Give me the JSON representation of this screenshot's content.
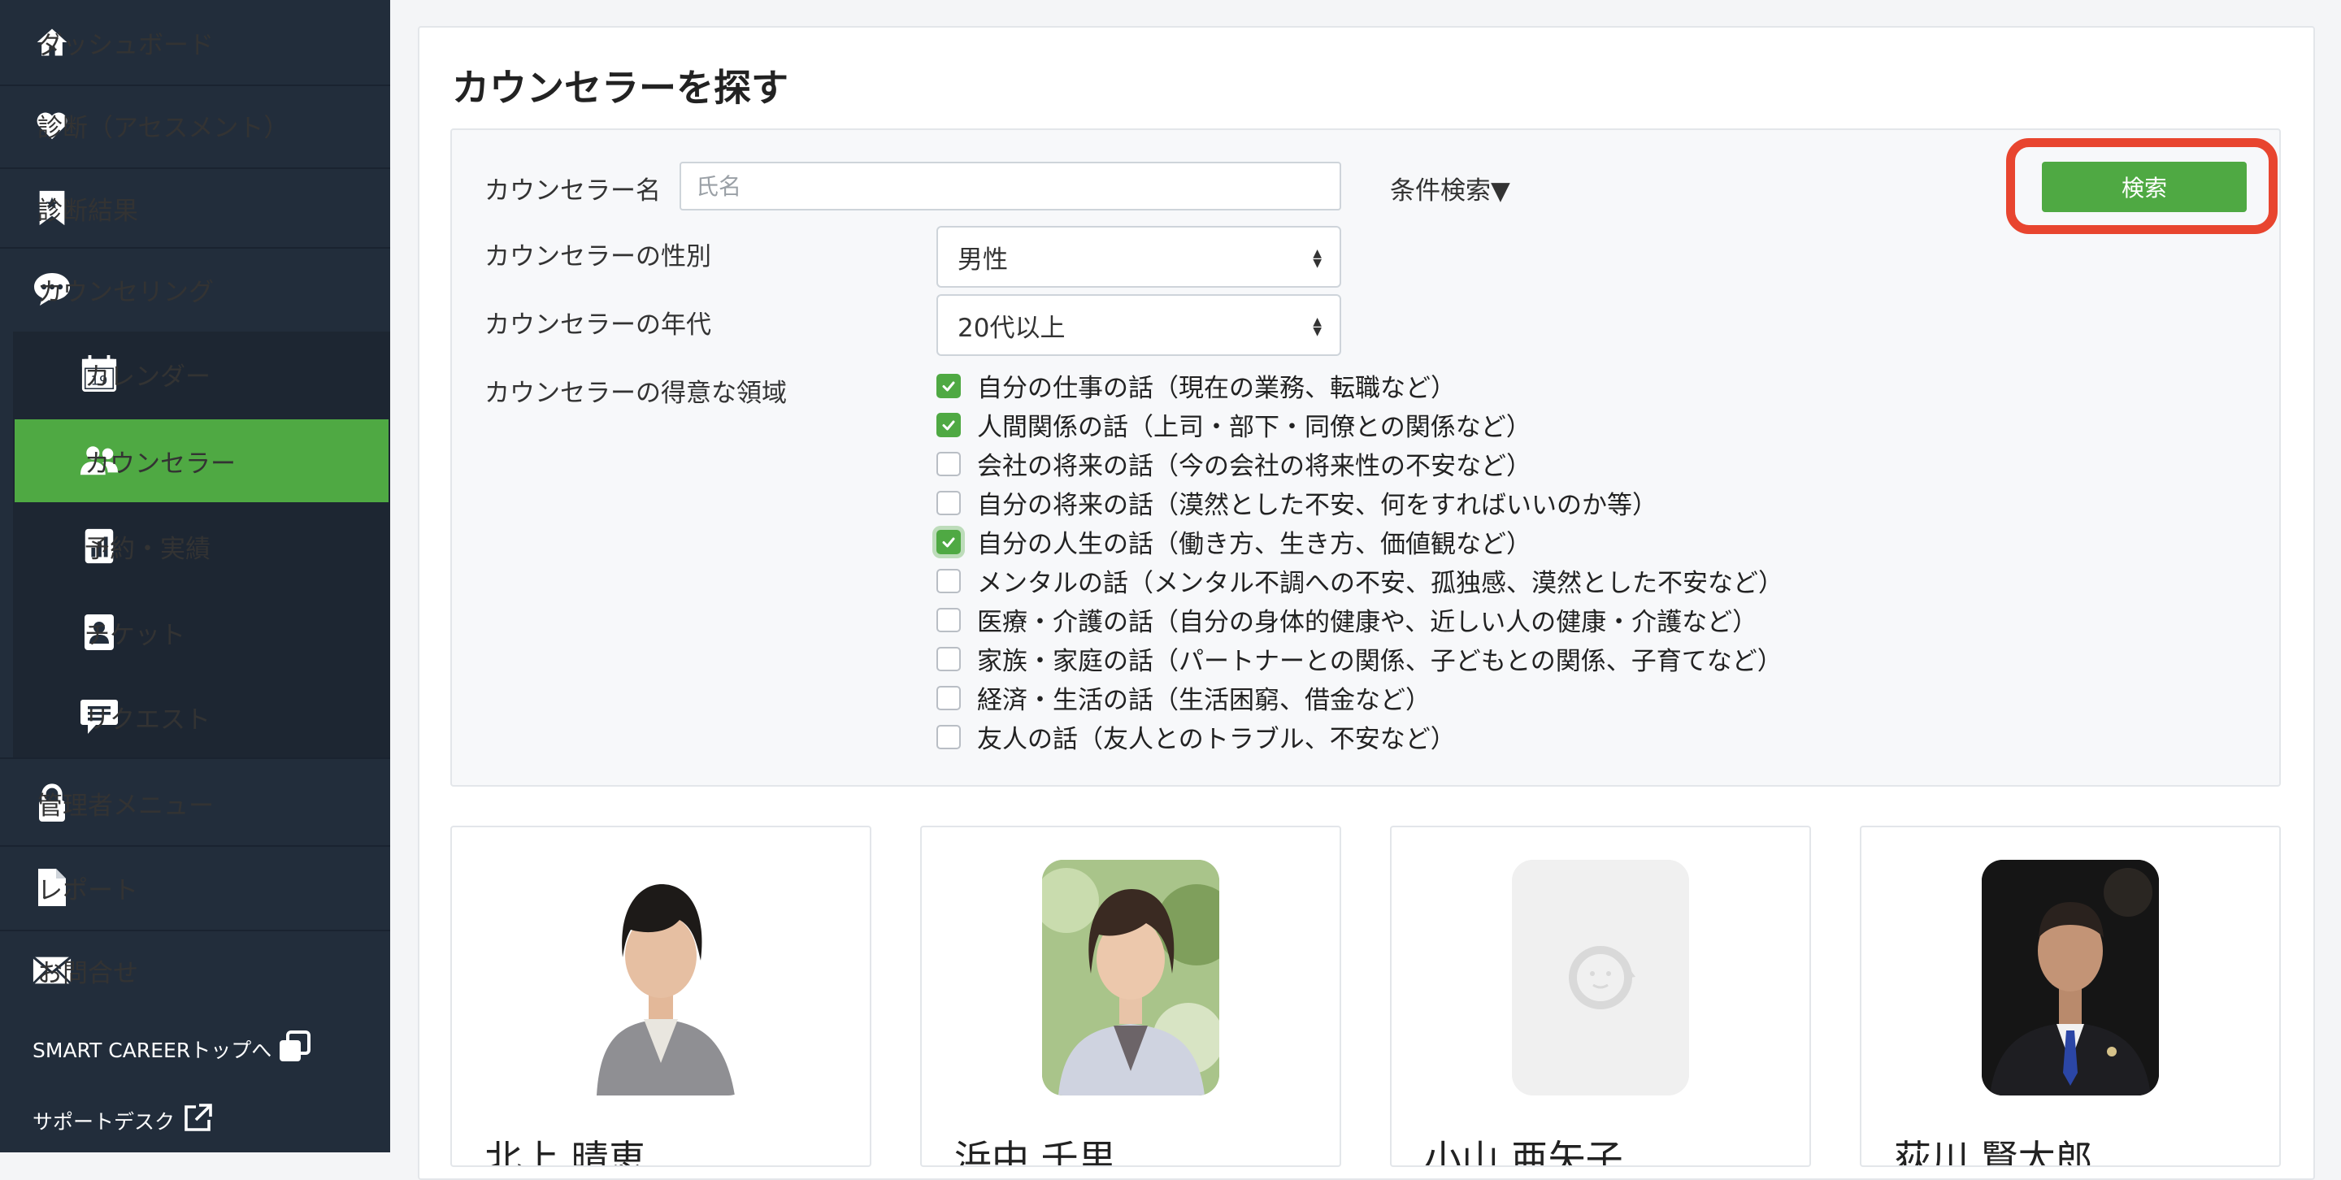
{
  "sidebar": {
    "items": [
      {
        "label": "ダッシュボード",
        "icon": "home-icon"
      },
      {
        "label": "診断（アセスメント）",
        "icon": "heart-icon"
      },
      {
        "label": "診断結果",
        "icon": "bookmark-icon"
      },
      {
        "label": "カウンセリング",
        "icon": "chat-bubble-icon"
      },
      {
        "label": "カレンダー",
        "icon": "calendar-icon",
        "icon_text": "19"
      },
      {
        "label": "カウンセラー",
        "icon": "users-icon"
      },
      {
        "label": "予約・実績",
        "icon": "chart-icon"
      },
      {
        "label": "チケット",
        "icon": "id-badge-icon"
      },
      {
        "label": "リクエスト",
        "icon": "message-icon"
      },
      {
        "label": "管理者メニュー",
        "icon": "lock-icon"
      },
      {
        "label": "レポート",
        "icon": "file-icon"
      },
      {
        "label": "お問合せ",
        "icon": "envelope-icon"
      }
    ],
    "footer": [
      {
        "label": "SMART CAREERトップへ",
        "icon": "window-restore-icon"
      },
      {
        "label": "サポートデスク",
        "icon": "external-link-icon"
      }
    ]
  },
  "page": {
    "title": "カウンセラーを探す"
  },
  "search": {
    "name_label": "カウンセラー名",
    "name_placeholder": "氏名",
    "name_value": "",
    "conditions_toggle": "条件検索▼",
    "search_button": "検索",
    "gender_label": "カウンセラーの性別",
    "gender_value": "男性",
    "age_label": "カウンセラーの年代",
    "age_value": "20代以上",
    "specialty_label": "カウンセラーの得意な領域",
    "specialties": [
      {
        "label": "自分の仕事の話（現在の業務、転職など）",
        "checked": true
      },
      {
        "label": "人間関係の話（上司・部下・同僚との関係など）",
        "checked": true
      },
      {
        "label": "会社の将来の話（今の会社の将来性の不安など）",
        "checked": false
      },
      {
        "label": "自分の将来の話（漠然とした不安、何をすればいいのか等）",
        "checked": false
      },
      {
        "label": "自分の人生の話（働き方、生き方、価値観など）",
        "checked": true
      },
      {
        "label": "メンタルの話（メンタル不調への不安、孤独感、漠然とした不安など）",
        "checked": false
      },
      {
        "label": "医療・介護の話（自分の身体的健康や、近しい人の健康・介護など）",
        "checked": false
      },
      {
        "label": "家族・家庭の話（パートナーとの関係、子どもとの関係、子育てなど）",
        "checked": false
      },
      {
        "label": "経済・生活の話（生活困窮、借金など）",
        "checked": false
      },
      {
        "label": "友人の話（友人とのトラブル、不安など）",
        "checked": false
      }
    ]
  },
  "counselors": [
    {
      "name": "北上 晴恵"
    },
    {
      "name": "浜中 千里"
    },
    {
      "name": "小山 亜矢子"
    },
    {
      "name": "荻川 賢太郎"
    }
  ],
  "colors": {
    "sidebar_bg": "#222d3b",
    "accent_green": "#4fa943",
    "highlight_red": "#e8452f"
  }
}
